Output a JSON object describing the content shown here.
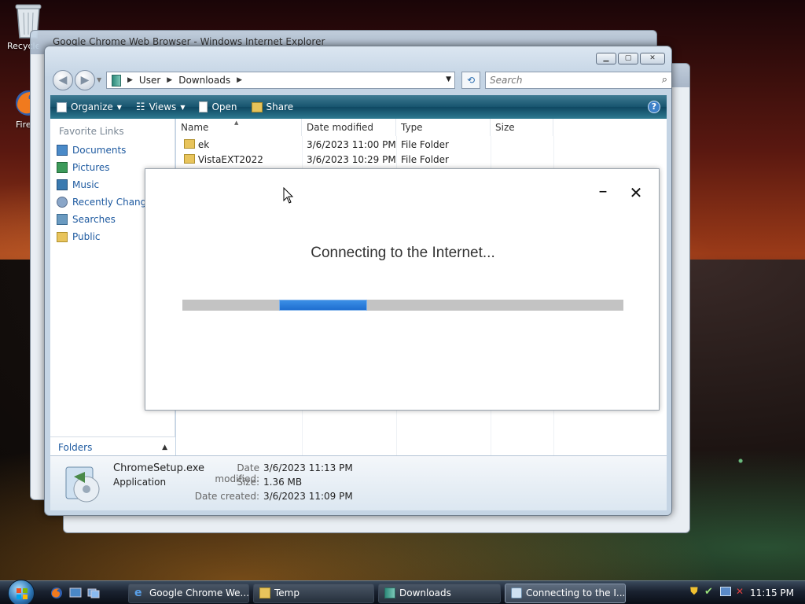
{
  "desktop": {
    "icons": [
      {
        "label": "Recycle Bin",
        "icon": "recycle-bin-icon"
      },
      {
        "label": "Firefox",
        "icon": "firefox-icon"
      }
    ]
  },
  "back_window": {
    "title": "Google Chrome Web Browser - Windows Internet Explorer"
  },
  "explorer": {
    "breadcrumb": [
      "User",
      "Downloads"
    ],
    "search_placeholder": "Search",
    "toolbar": {
      "organize": "Organize",
      "views": "Views",
      "open": "Open",
      "share": "Share"
    },
    "favorite_links_header": "Favorite Links",
    "favorite_links": [
      "Documents",
      "Pictures",
      "Music",
      "Recently Changed",
      "Searches",
      "Public"
    ],
    "folders_label": "Folders",
    "columns": [
      "Name",
      "Date modified",
      "Type",
      "Size"
    ],
    "files": [
      {
        "name": "ek",
        "date": "3/6/2023 11:00 PM",
        "type": "File Folder",
        "size": ""
      },
      {
        "name": "VistaEXT2022",
        "date": "3/6/2023 10:29 PM",
        "type": "File Folder",
        "size": ""
      }
    ],
    "details": {
      "filename": "ChromeSetup.exe",
      "filetype": "Application",
      "date_modified_label": "Date modified:",
      "date_modified": "3/6/2023 11:13 PM",
      "size_label": "Size:",
      "size": "1.36 MB",
      "date_created_label": "Date created:",
      "date_created": "3/6/2023 11:09 PM"
    }
  },
  "installer": {
    "message": "Connecting to the Internet...",
    "progress_chunk_start": 0.22,
    "progress_chunk_width": 0.2,
    "progress_color": "#1f6ed0"
  },
  "taskbar": {
    "buttons": [
      {
        "label": "Google Chrome We...",
        "icon": "ie-icon"
      },
      {
        "label": "Temp",
        "icon": "folder-icon"
      },
      {
        "label": "Downloads",
        "icon": "explorer-icon"
      },
      {
        "label": "Connecting to the I...",
        "icon": "installer-icon"
      }
    ],
    "clock": "11:15 PM"
  }
}
